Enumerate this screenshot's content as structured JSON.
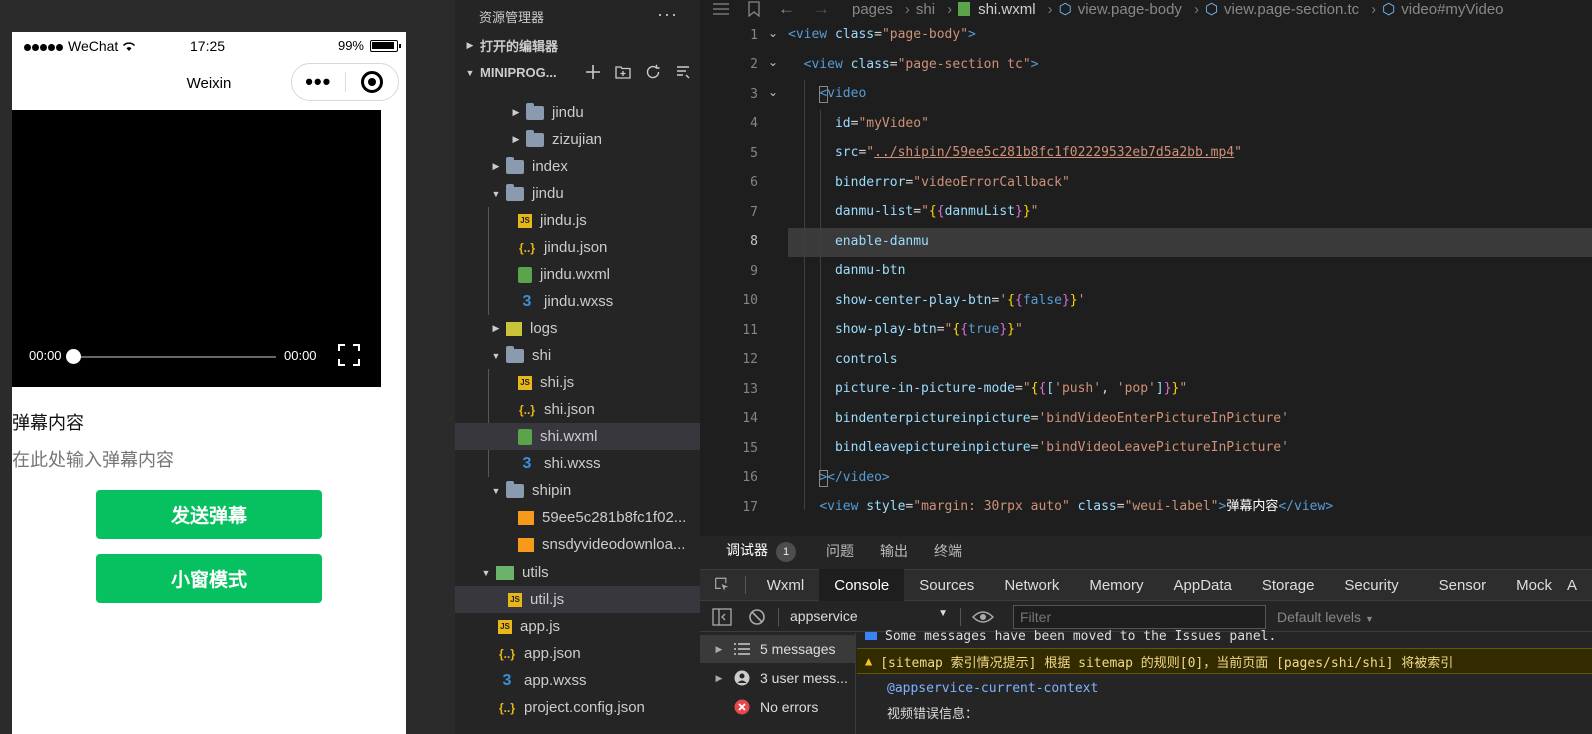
{
  "simulator": {
    "status": {
      "carrier": "WeChat",
      "time": "17:25",
      "battery": "99%"
    },
    "nav_title": "Weixin",
    "video": {
      "current_time": "00:00",
      "duration": "00:00",
      "progress": 0
    },
    "danmu_label": "弹幕内容",
    "danmu_placeholder": "在此处输入弹幕内容",
    "send_button": "发送弹幕",
    "pip_button": "小窗模式"
  },
  "explorer": {
    "title": "资源管理器",
    "open_editors": "打开的编辑器",
    "project": "MINIPROG...",
    "items": [
      {
        "label": "jindu",
        "type": "folder",
        "state": "collapsed"
      },
      {
        "label": "zizujian",
        "type": "folder",
        "state": "collapsed"
      },
      {
        "label": "index",
        "type": "folder",
        "state": "collapsed"
      },
      {
        "label": "jindu",
        "type": "folder",
        "state": "expanded"
      },
      {
        "label": "jindu.js",
        "type": "js"
      },
      {
        "label": "jindu.json",
        "type": "json"
      },
      {
        "label": "jindu.wxml",
        "type": "wxml"
      },
      {
        "label": "jindu.wxss",
        "type": "wxss"
      },
      {
        "label": "logs",
        "type": "folder",
        "state": "collapsed"
      },
      {
        "label": "shi",
        "type": "folder",
        "state": "expanded"
      },
      {
        "label": "shi.js",
        "type": "js"
      },
      {
        "label": "shi.json",
        "type": "json"
      },
      {
        "label": "shi.wxml",
        "type": "wxml",
        "selected": true
      },
      {
        "label": "shi.wxss",
        "type": "wxss"
      },
      {
        "label": "shipin",
        "type": "folder",
        "state": "expanded"
      },
      {
        "label": "59ee5c281b8fc1f02...",
        "type": "mp4"
      },
      {
        "label": "snsdyvideodownloa...",
        "type": "mp4"
      },
      {
        "label": "utils",
        "type": "folder",
        "state": "expanded"
      },
      {
        "label": "util.js",
        "type": "js",
        "selected": true
      },
      {
        "label": "app.js",
        "type": "js"
      },
      {
        "label": "app.json",
        "type": "json"
      },
      {
        "label": "app.wxss",
        "type": "wxss"
      },
      {
        "label": "project.config.json",
        "type": "json"
      }
    ]
  },
  "editor": {
    "breadcrumb": [
      "pages",
      "shi",
      "shi.wxml",
      "view.page-body",
      "view.page-section.tc",
      "video#myVideo"
    ],
    "current_line": 8,
    "line_numbers": [
      "1",
      "2",
      "3",
      "4",
      "5",
      "6",
      "7",
      "8",
      "9",
      "10",
      "11",
      "12",
      "13",
      "14",
      "15",
      "16",
      "17"
    ]
  },
  "devtools": {
    "top_tabs": [
      "调试器",
      "问题",
      "输出",
      "终端"
    ],
    "debugger_badge": "1",
    "panels": [
      "Wxml",
      "Console",
      "Sources",
      "Network",
      "Memory",
      "AppData",
      "Storage",
      "Security",
      "Sensor",
      "Mock",
      "A"
    ],
    "active_panel": "Console",
    "context": "appservice",
    "filter_placeholder": "Filter",
    "levels": "Default levels",
    "sidebar": [
      {
        "label": "5 messages"
      },
      {
        "label": "3 user mess..."
      },
      {
        "label": "No errors"
      }
    ],
    "logs": {
      "moved": "Some messages have been moved to the Issues panel.",
      "sitemap": "[sitemap 索引情况提示] 根据 sitemap 的规则[0]，当前页面 [pages/shi/shi] 将被索引",
      "context": "@appservice-current-context",
      "video_error": "视频错误信息："
    }
  }
}
